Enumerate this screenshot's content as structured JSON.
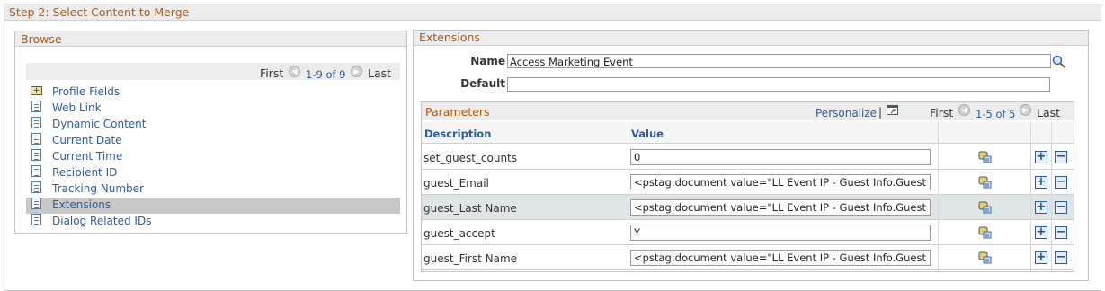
{
  "step": {
    "title": "Step 2: Select Content to Merge"
  },
  "browse": {
    "title": "Browse",
    "nav": {
      "first": "First",
      "range": "1-9 of 9",
      "last": "Last"
    },
    "items": [
      {
        "label": "Profile Fields",
        "icon": "folder-plus-icon"
      },
      {
        "label": "Web Link",
        "icon": "document-icon"
      },
      {
        "label": "Dynamic Content",
        "icon": "document-icon"
      },
      {
        "label": "Current Date",
        "icon": "document-icon"
      },
      {
        "label": "Current Time",
        "icon": "document-icon"
      },
      {
        "label": "Recipient ID",
        "icon": "document-icon"
      },
      {
        "label": "Tracking Number",
        "icon": "document-icon"
      },
      {
        "label": "Extensions",
        "icon": "document-icon",
        "selected": true
      },
      {
        "label": "Dialog Related IDs",
        "icon": "document-icon"
      }
    ]
  },
  "extensions": {
    "title": "Extensions",
    "name_label": "Name",
    "name_value": "Access Marketing Event",
    "default_label": "Default",
    "default_value": "",
    "params": {
      "title": "Parameters",
      "personalize": "Personalize",
      "separator": "|",
      "nav": {
        "first": "First",
        "range": "1-5 of 5",
        "last": "Last"
      },
      "columns": {
        "description": "Description",
        "value": "Value"
      },
      "rows": [
        {
          "description": "set_guest_counts",
          "value": "0"
        },
        {
          "description": "guest_Email",
          "value": "<pstag:document value=\"LL Event IP - Guest Info.Guest I"
        },
        {
          "description": "guest_Last Name",
          "value": "<pstag:document value=\"LL Event IP - Guest Info.Guest I",
          "selected": true
        },
        {
          "description": "guest_accept",
          "value": "Y"
        },
        {
          "description": "guest_First Name",
          "value": "<pstag:document value=\"LL Event IP - Guest Info.Guest I"
        }
      ],
      "add": "+",
      "remove": "−"
    }
  },
  "icons": {
    "prev": "◀",
    "next": "▶"
  },
  "colors": {
    "title": "#b05a10",
    "link": "#2a5d9f",
    "header_bg": "#ececec",
    "selected_row": "#dfe4e6"
  }
}
